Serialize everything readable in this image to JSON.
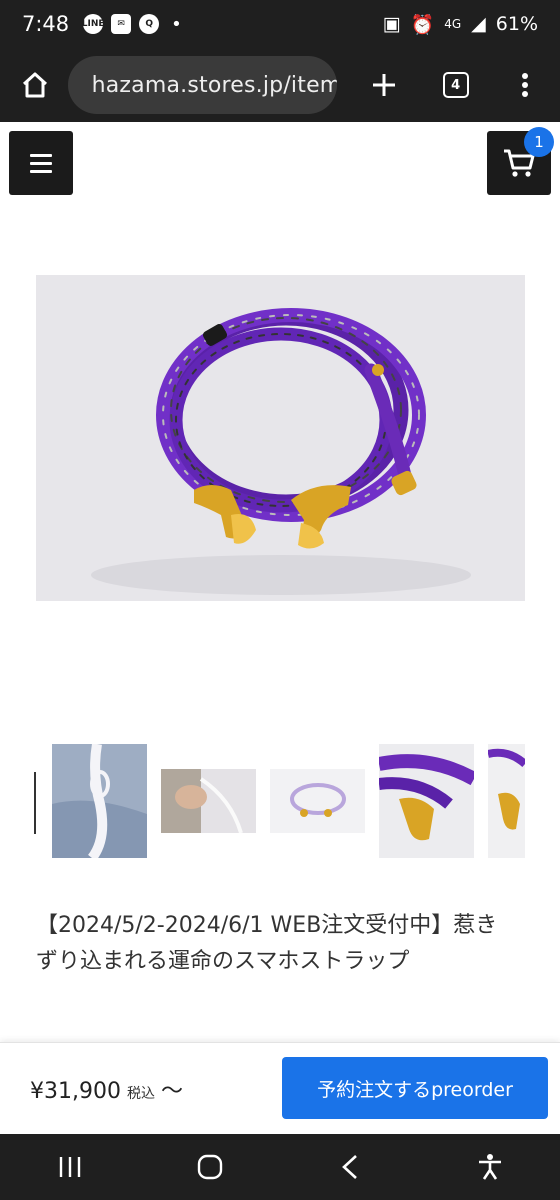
{
  "status_bar": {
    "time": "7:48",
    "notification_icons": [
      "LINE",
      "mail-icon",
      "search-app-icon"
    ],
    "network": "4G",
    "battery": "61%"
  },
  "browser": {
    "url": "hazama.stores.jp/items",
    "tab_count": "4"
  },
  "header": {
    "cart_count": "1"
  },
  "product": {
    "title": "【2024/5/2-2024/6/1 WEB注文受付中】惹きずり込まれる運命のスマホストラップ",
    "price": "¥31,900",
    "tax_label": "税込",
    "from_label": "〜",
    "order_button": "予約注文するpreorder"
  },
  "colors": {
    "accent": "#1a73e8",
    "dark": "#1b1b1b",
    "strap_purple": "#6a2bb8",
    "gold": "#d9a425"
  }
}
